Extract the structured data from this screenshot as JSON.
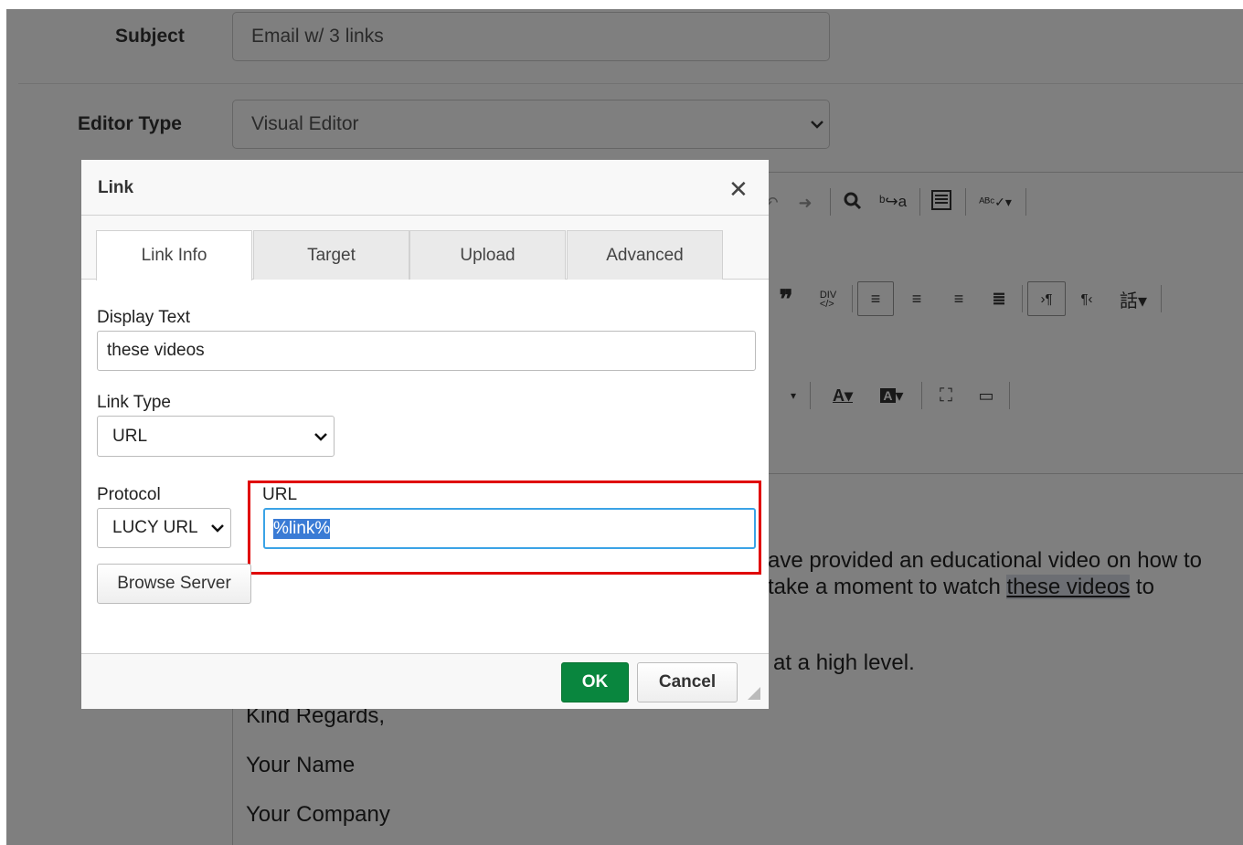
{
  "form": {
    "subject_label": "Subject",
    "subject_value": "Email w/ 3 links",
    "editor_type_label": "Editor Type",
    "editor_type_value": "Visual Editor"
  },
  "editor": {
    "body_line1_tail": "ave provided an educational video on how to",
    "body_line2_pre": "take a moment to watch ",
    "body_line2_link": "these videos",
    "body_line2_post": " to",
    "body_line3": "at a high level.",
    "closing": "Kind Regards,",
    "name": "Your Name",
    "company": "Your Company"
  },
  "dialog": {
    "title": "Link",
    "close_glyph": "✕",
    "tabs": [
      {
        "label": "Link Info",
        "active": true
      },
      {
        "label": "Target",
        "active": false
      },
      {
        "label": "Upload",
        "active": false
      },
      {
        "label": "Advanced",
        "active": false
      }
    ],
    "display_text_label": "Display Text",
    "display_text_value": "these videos",
    "link_type_label": "Link Type",
    "link_type_value": "URL",
    "protocol_label": "Protocol",
    "protocol_value": "LUCY URL",
    "url_label": "URL",
    "url_value": "%link%",
    "browse_button": "Browse Server",
    "ok_button": "OK",
    "cancel_button": "Cancel"
  },
  "colors": {
    "ok_green": "#09863e",
    "highlight_red": "#e00000",
    "focus_blue": "#3ba3e6",
    "overlay": "rgba(0,0,0,0.5)"
  }
}
